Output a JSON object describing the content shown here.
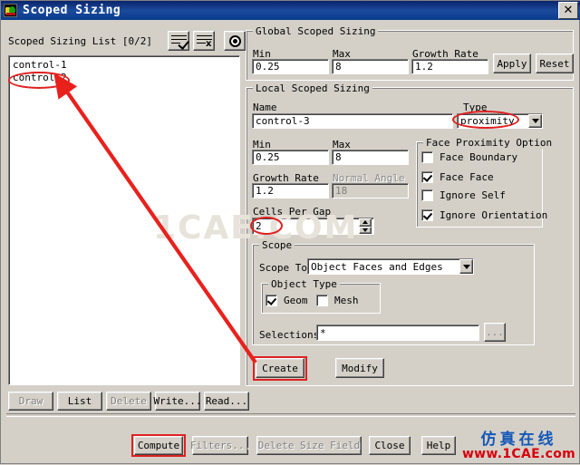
{
  "window": {
    "title": "Scoped Sizing",
    "icon": "app-icon",
    "close_label": "✕"
  },
  "list_panel": {
    "header": "Scoped Sizing List  [0/2]",
    "items": [
      "control-1",
      "control-2"
    ],
    "toolbar": [
      {
        "name": "select-all-icon",
        "tip": "select all"
      },
      {
        "name": "deselect-all-icon",
        "tip": "deselect all",
        "glyph": "x"
      },
      {
        "name": "highlight-icon",
        "tip": "highlight"
      }
    ],
    "buttons": [
      {
        "label": "Draw",
        "disabled": true
      },
      {
        "label": "List",
        "disabled": false
      },
      {
        "label": "Delete",
        "disabled": true
      },
      {
        "label": "Write...",
        "disabled": false
      },
      {
        "label": "Read...",
        "disabled": false
      }
    ]
  },
  "global": {
    "legend": "Global Scoped Sizing",
    "min_label": "Min",
    "min_value": "0.25",
    "max_label": "Max",
    "max_value": "8",
    "growth_label": "Growth Rate",
    "growth_value": "1.2",
    "apply_label": "Apply",
    "reset_label": "Reset"
  },
  "local": {
    "legend": "Local Scoped Sizing",
    "name_label": "Name",
    "name_value": "control-3",
    "type_label": "Type",
    "type_value": "proximity",
    "min_label": "Min",
    "min_value": "0.25",
    "max_label": "Max",
    "max_value": "8",
    "growth_label": "Growth Rate",
    "growth_value": "1.2",
    "normal_angle_label": "Normal Angle",
    "normal_angle_value": "18",
    "cells_per_gap_label": "Cells Per Gap",
    "cells_per_gap_value": "2",
    "face_proximity": {
      "legend": "Face Proximity Option",
      "options": [
        {
          "label": "Face Boundary",
          "checked": false
        },
        {
          "label": "Face Face",
          "checked": true
        },
        {
          "label": "Ignore Self",
          "checked": false
        },
        {
          "label": "Ignore Orientation",
          "checked": true
        }
      ]
    },
    "scope": {
      "legend": "Scope",
      "scope_to_label": "Scope To",
      "scope_to_value": "Object Faces and Edges",
      "object_type": {
        "legend": "Object Type",
        "options": [
          {
            "label": "Geom",
            "checked": true
          },
          {
            "label": "Mesh",
            "checked": false
          }
        ]
      },
      "selections_label": "Selections",
      "selections_value": "*",
      "browse_label": "..."
    },
    "create_label": "Create",
    "modify_label": "Modify"
  },
  "footer": {
    "buttons": [
      {
        "label": "Compute",
        "disabled": false
      },
      {
        "label": "Filters...",
        "disabled": true
      },
      {
        "label": "Delete Size Field",
        "disabled": true
      },
      {
        "label": "Close",
        "disabled": false
      },
      {
        "label": "Help",
        "disabled": false
      }
    ]
  },
  "watermark": {
    "center": "1CAE.COM",
    "brand_cn": "仿真在线",
    "brand_url": "www.1CAE.com"
  },
  "annotations": {
    "accent_color": "#e02020",
    "callouts": [
      "control-2-ellipse",
      "type-ellipse",
      "cells-per-gap-ellipse",
      "create-rect",
      "compute-rect",
      "arrow-create-to-control2"
    ]
  }
}
